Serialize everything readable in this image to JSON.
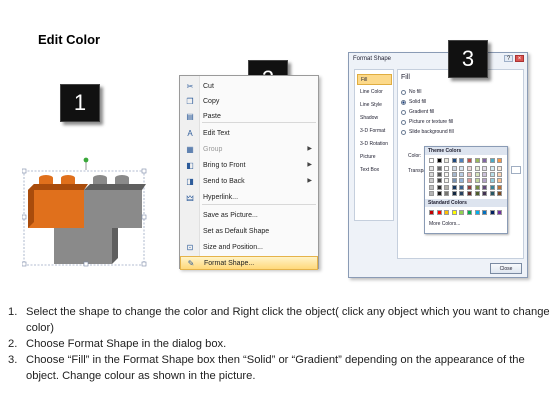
{
  "title": "Edit Color",
  "badges": {
    "b1": "1",
    "b2": "2",
    "b3": "3"
  },
  "bricks": {
    "orange": "#e0701c",
    "orange_dark": "#a94c0c",
    "gray": "#8a8a8a",
    "gray_dark": "#5f5f5f",
    "handle": "#3aa83a"
  },
  "context_menu": {
    "items": [
      {
        "label": "Cut",
        "icon": "scissors-icon"
      },
      {
        "label": "Copy",
        "icon": "copy-icon"
      },
      {
        "label": "Paste",
        "icon": "paste-icon"
      },
      {
        "label": "Edit Text",
        "icon": "edit-text-icon"
      },
      {
        "label": "Group",
        "icon": "group-icon",
        "disabled": true,
        "submenu": true
      },
      {
        "label": "Bring to Front",
        "icon": "bring-front-icon",
        "submenu": true
      },
      {
        "label": "Send to Back",
        "icon": "send-back-icon",
        "submenu": true
      },
      {
        "label": "Hyperlink...",
        "icon": "hyperlink-icon"
      },
      {
        "label": "Save as Picture...",
        "icon": ""
      },
      {
        "label": "Set as Default Shape",
        "icon": ""
      },
      {
        "label": "Size and Position...",
        "icon": "size-position-icon"
      },
      {
        "label": "Format Shape...",
        "icon": "format-shape-icon",
        "highlighted": true
      }
    ]
  },
  "dialog": {
    "title": "Format Shape",
    "nav": [
      "Fill",
      "Line Color",
      "Line Style",
      "Shadow",
      "3-D Format",
      "3-D Rotation",
      "Picture",
      "Text Box"
    ],
    "fill_heading": "Fill",
    "options": [
      {
        "label": "No fill",
        "selected": false
      },
      {
        "label": "Solid fill",
        "selected": true
      },
      {
        "label": "Gradient fill",
        "selected": false
      },
      {
        "label": "Picture or texture fill",
        "selected": false
      },
      {
        "label": "Slide background fill",
        "selected": false
      }
    ],
    "color_label": "Color:",
    "transparency_label": "Transpar",
    "theme_colors_label": "Theme Colors",
    "standard_colors_label": "Standard Colors",
    "more_colors_label": "More Colors...",
    "close_label": "Close",
    "theme_top_row": [
      "#ffffff",
      "#000000",
      "#eeece1",
      "#1f497d",
      "#4f81bd",
      "#c0504d",
      "#9bbb59",
      "#8064a2",
      "#4bacc6",
      "#f79646"
    ],
    "standard_colors": [
      "#c00000",
      "#ff0000",
      "#ffc000",
      "#ffff00",
      "#92d050",
      "#00b050",
      "#00b0f0",
      "#0070c0",
      "#002060",
      "#7030a0"
    ]
  },
  "instructions": [
    {
      "num": "1.",
      "text": "Select the shape to change the color and Right click the object( click any object which you want to change color)"
    },
    {
      "num": "2.",
      "text": "Choose Format Shape in the dialog box."
    },
    {
      "num": "3.",
      "text": "Choose “Fill” in the Format Shape box then “Solid” or “Gradient” depending on the appearance of the object. Change colour as shown in the picture."
    }
  ]
}
